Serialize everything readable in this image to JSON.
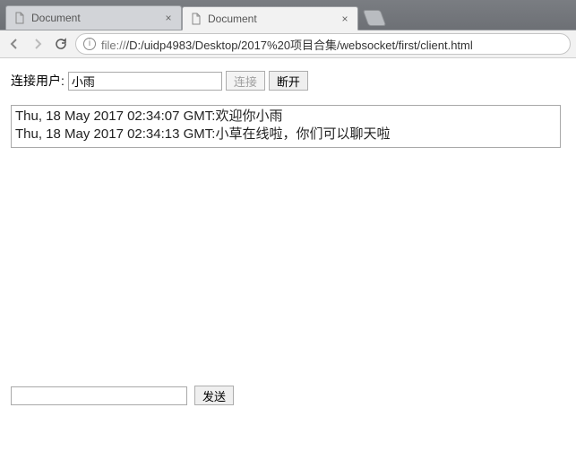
{
  "browser": {
    "tabs": [
      {
        "title": "Document",
        "active": false
      },
      {
        "title": "Document",
        "active": true
      }
    ],
    "url_scheme": "file://",
    "url_path": "/D:/uidp4983/Desktop/2017%20项目合集/websocket/first/client.html"
  },
  "form": {
    "user_label": "连接用户:",
    "user_value": "小雨",
    "connect_label": "连接",
    "disconnect_label": "断开",
    "send_label": "发送",
    "message_value": ""
  },
  "log": {
    "lines": [
      "Thu, 18 May 2017 02:34:07 GMT:欢迎你小雨",
      "Thu, 18 May 2017 02:34:13 GMT:小草在线啦，你们可以聊天啦"
    ]
  }
}
